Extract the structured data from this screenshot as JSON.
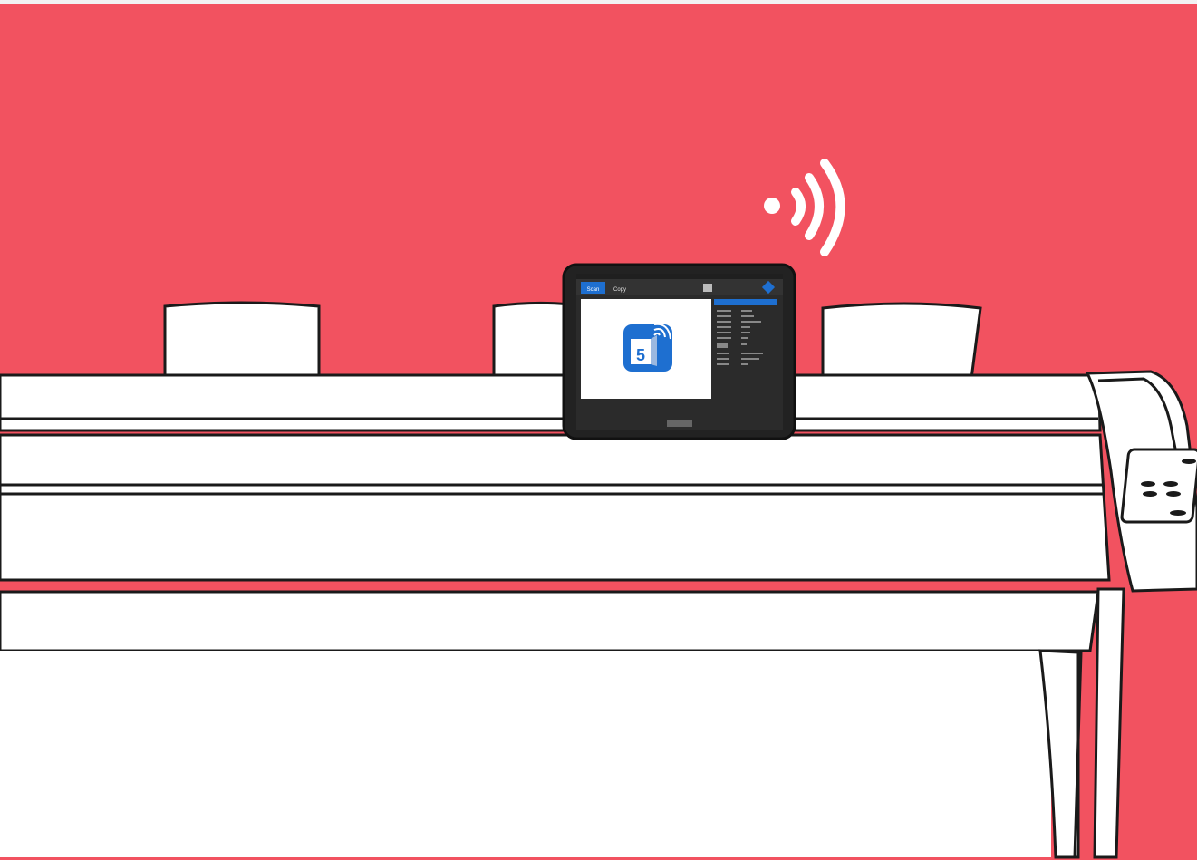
{
  "colors": {
    "background": "#f25260",
    "scanner_body": "#ffffff",
    "outline": "#1a1a1a",
    "tablet_frame": "#222222",
    "app_dark": "#2b2b2b",
    "accent_blue": "#1e6fd0",
    "wifi_white": "#ffffff"
  },
  "icons": {
    "wifi": "wifi-signal-icon",
    "app": "scan-app-icon",
    "info": "info-icon",
    "menu": "menu-icon"
  },
  "tablet_app": {
    "tabs": [
      "Scan",
      "Copy"
    ],
    "app_icon_number": "5",
    "settings_panel_rows": 10
  }
}
